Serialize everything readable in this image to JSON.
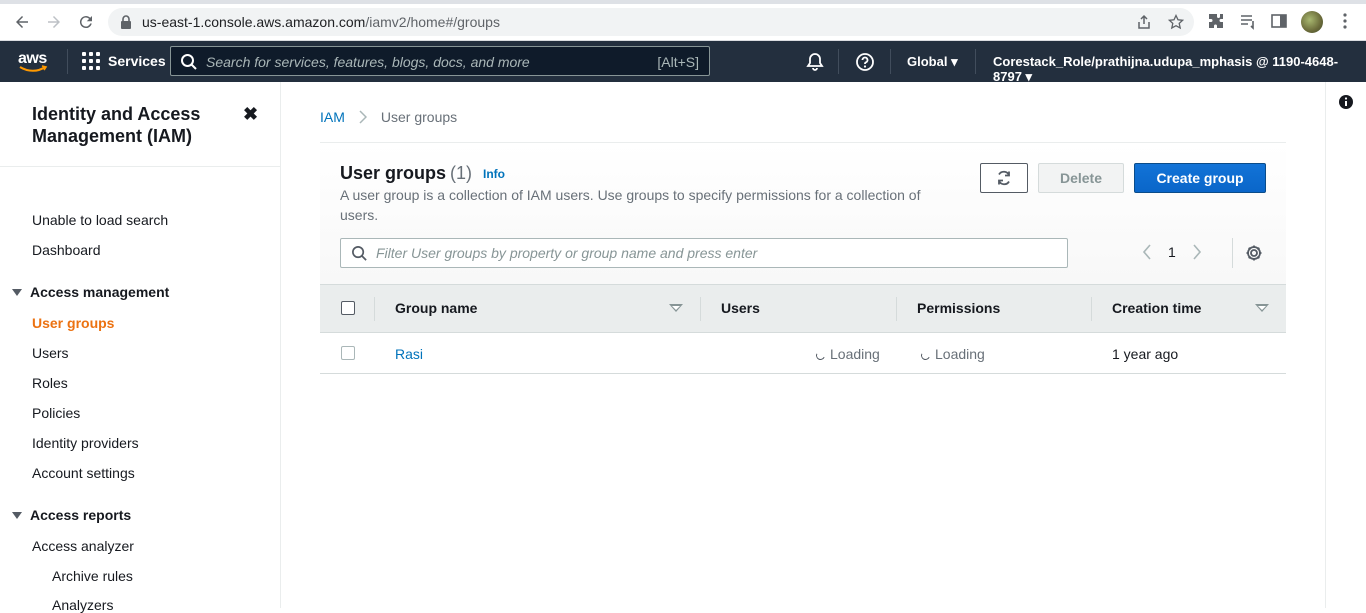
{
  "browser": {
    "url_host": "us-east-1.console.aws.amazon.com",
    "url_path": "/iamv2/home#/groups"
  },
  "aws_nav": {
    "logo": "aws",
    "services_label": "Services",
    "search_placeholder": "Search for services, features, blogs, docs, and more",
    "search_shortcut": "[Alt+S]",
    "region_label": "Global",
    "account_label": "Corestack_Role/prathijna.udupa_mphasis @ 1190-4648-8797"
  },
  "sidebar": {
    "title": "Identity and Access Management (IAM)",
    "close_icon": "close-icon",
    "top_links": [
      "Unable to load search",
      "Dashboard"
    ],
    "access_management": {
      "label": "Access management",
      "items": [
        "User groups",
        "Users",
        "Roles",
        "Policies",
        "Identity providers",
        "Account settings"
      ]
    },
    "access_reports": {
      "label": "Access reports",
      "items": [
        "Access analyzer",
        "Archive rules",
        "Analyzers"
      ]
    }
  },
  "breadcrumb": {
    "root": "IAM",
    "current": "User groups"
  },
  "panel": {
    "title": "User groups",
    "count": "(1)",
    "info_label": "Info",
    "description": "A user group is a collection of IAM users. Use groups to specify permissions for a collection of users.",
    "delete_label": "Delete",
    "create_label": "Create group",
    "filter_placeholder": "Filter User groups by property or group name and press enter",
    "page_number": "1"
  },
  "table": {
    "columns": [
      "Group name",
      "Users",
      "Permissions",
      "Creation time"
    ],
    "rows": [
      {
        "group_name": "Rasi",
        "users": "Loading",
        "permissions": "Loading",
        "creation_time": "1 year ago"
      }
    ]
  },
  "colors": {
    "aws_nav_bg": "#232f3e",
    "active_link": "#ec7211",
    "link": "#0073bb",
    "primary_button": "#0a6ad3"
  }
}
